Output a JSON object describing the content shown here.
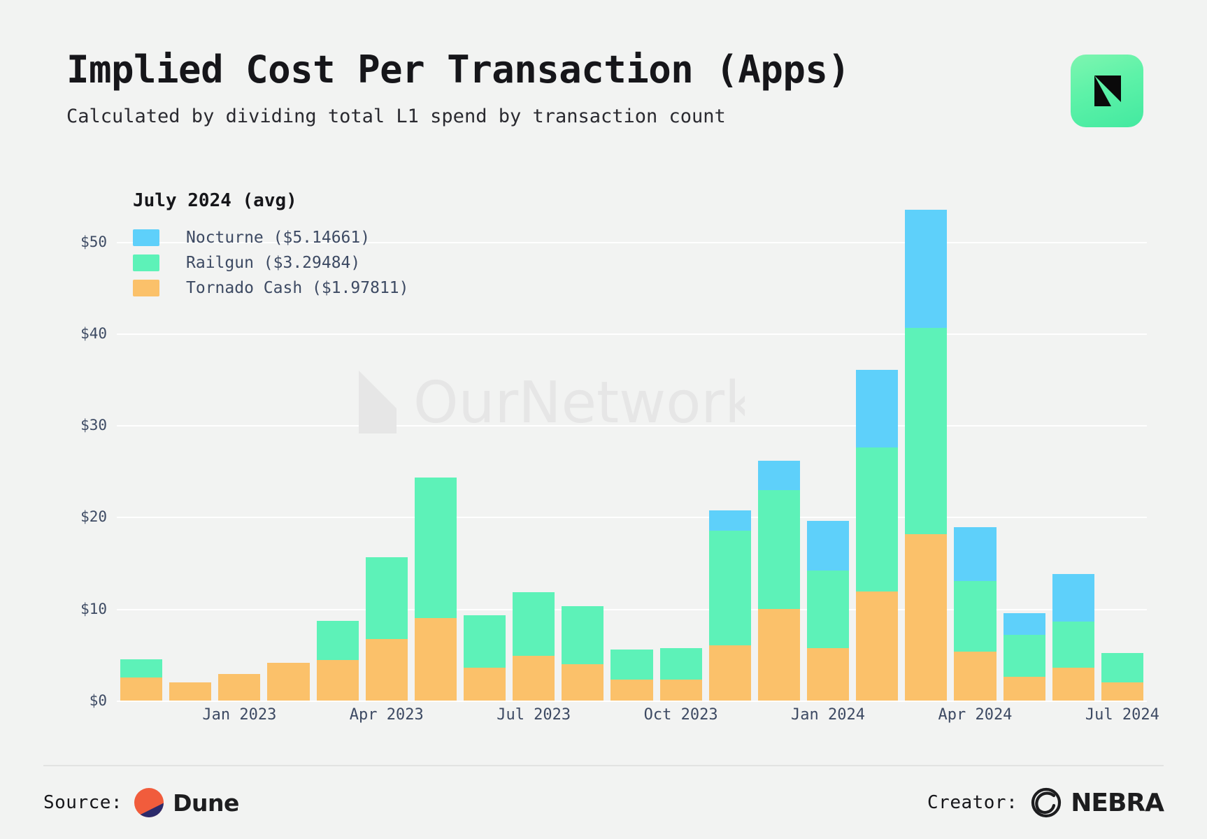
{
  "header": {
    "title": "Implied Cost Per Transaction (Apps)",
    "subtitle": "Calculated by dividing total L1 spend by transaction count",
    "logo_icon": "nebra-logo-icon"
  },
  "legend": {
    "title": "July 2024 (avg)",
    "items": [
      {
        "label": "Nocturne ($5.14661)",
        "color": "#5ed0fa"
      },
      {
        "label": "Railgun ($3.29484)",
        "color": "#5df2b8"
      },
      {
        "label": "Tornado Cash ($1.97811)",
        "color": "#fbc16a"
      }
    ]
  },
  "watermark": {
    "text": "OurNetwork"
  },
  "footer": {
    "source_label": "Source:",
    "source_name": "Dune",
    "source_icon": "dune-logo-icon",
    "creator_label": "Creator:",
    "creator_name": "NEBRA",
    "creator_icon": "nebra-mark-icon"
  },
  "chart_data": {
    "type": "bar",
    "title": "Implied Cost Per Transaction (Apps)",
    "subtitle": "Calculated by dividing total L1 spend by transaction count",
    "stacked": true,
    "xlabel": "",
    "ylabel": "",
    "ylim": [
      0,
      55
    ],
    "grid": true,
    "legend_position": "top-left",
    "ytick_labels": [
      "$0",
      "$10",
      "$20",
      "$30",
      "$40",
      "$50"
    ],
    "ytick_values": [
      0,
      10,
      20,
      30,
      40,
      50
    ],
    "xtick_labels": [
      "Jan 2023",
      "Apr 2023",
      "Jul 2023",
      "Oct 2023",
      "Jan 2024",
      "Apr 2024",
      "Jul 2024"
    ],
    "xtick_indices": [
      2,
      5,
      8,
      11,
      14,
      17,
      20
    ],
    "categories": [
      "Nov 2022",
      "Dec 2022",
      "Jan 2023",
      "Feb 2023",
      "Mar 2023",
      "Apr 2023",
      "May 2023",
      "Jun 2023",
      "Jul 2023",
      "Aug 2023",
      "Sep 2023",
      "Oct 2023",
      "Nov 2023",
      "Dec 2023",
      "Jan 2024",
      "Feb 2024",
      "Mar 2024",
      "Apr 2024",
      "May 2024",
      "Jun 2024",
      "Jul 2024"
    ],
    "series": [
      {
        "name": "Tornado Cash",
        "color": "#fbc16a",
        "values": [
          2.5,
          2.0,
          2.9,
          4.1,
          4.4,
          6.7,
          9.0,
          3.6,
          4.9,
          4.0,
          2.3,
          2.3,
          6.0,
          10.0,
          5.7,
          11.9,
          18.1,
          5.3,
          2.6,
          3.6,
          2.0
        ]
      },
      {
        "name": "Railgun",
        "color": "#5df2b8",
        "values": [
          2.0,
          0.0,
          0.0,
          0.0,
          4.3,
          8.9,
          15.3,
          5.7,
          6.9,
          6.3,
          3.3,
          3.4,
          12.5,
          12.9,
          8.5,
          15.7,
          22.5,
          7.7,
          4.6,
          5.0,
          3.2
        ]
      },
      {
        "name": "Nocturne",
        "color": "#5ed0fa",
        "values": [
          0.0,
          0.0,
          0.0,
          0.0,
          0.0,
          0.0,
          0.0,
          0.0,
          0.0,
          0.0,
          0.0,
          0.0,
          2.2,
          3.2,
          5.4,
          8.4,
          12.9,
          5.9,
          2.3,
          5.2,
          0.0
        ]
      }
    ]
  }
}
